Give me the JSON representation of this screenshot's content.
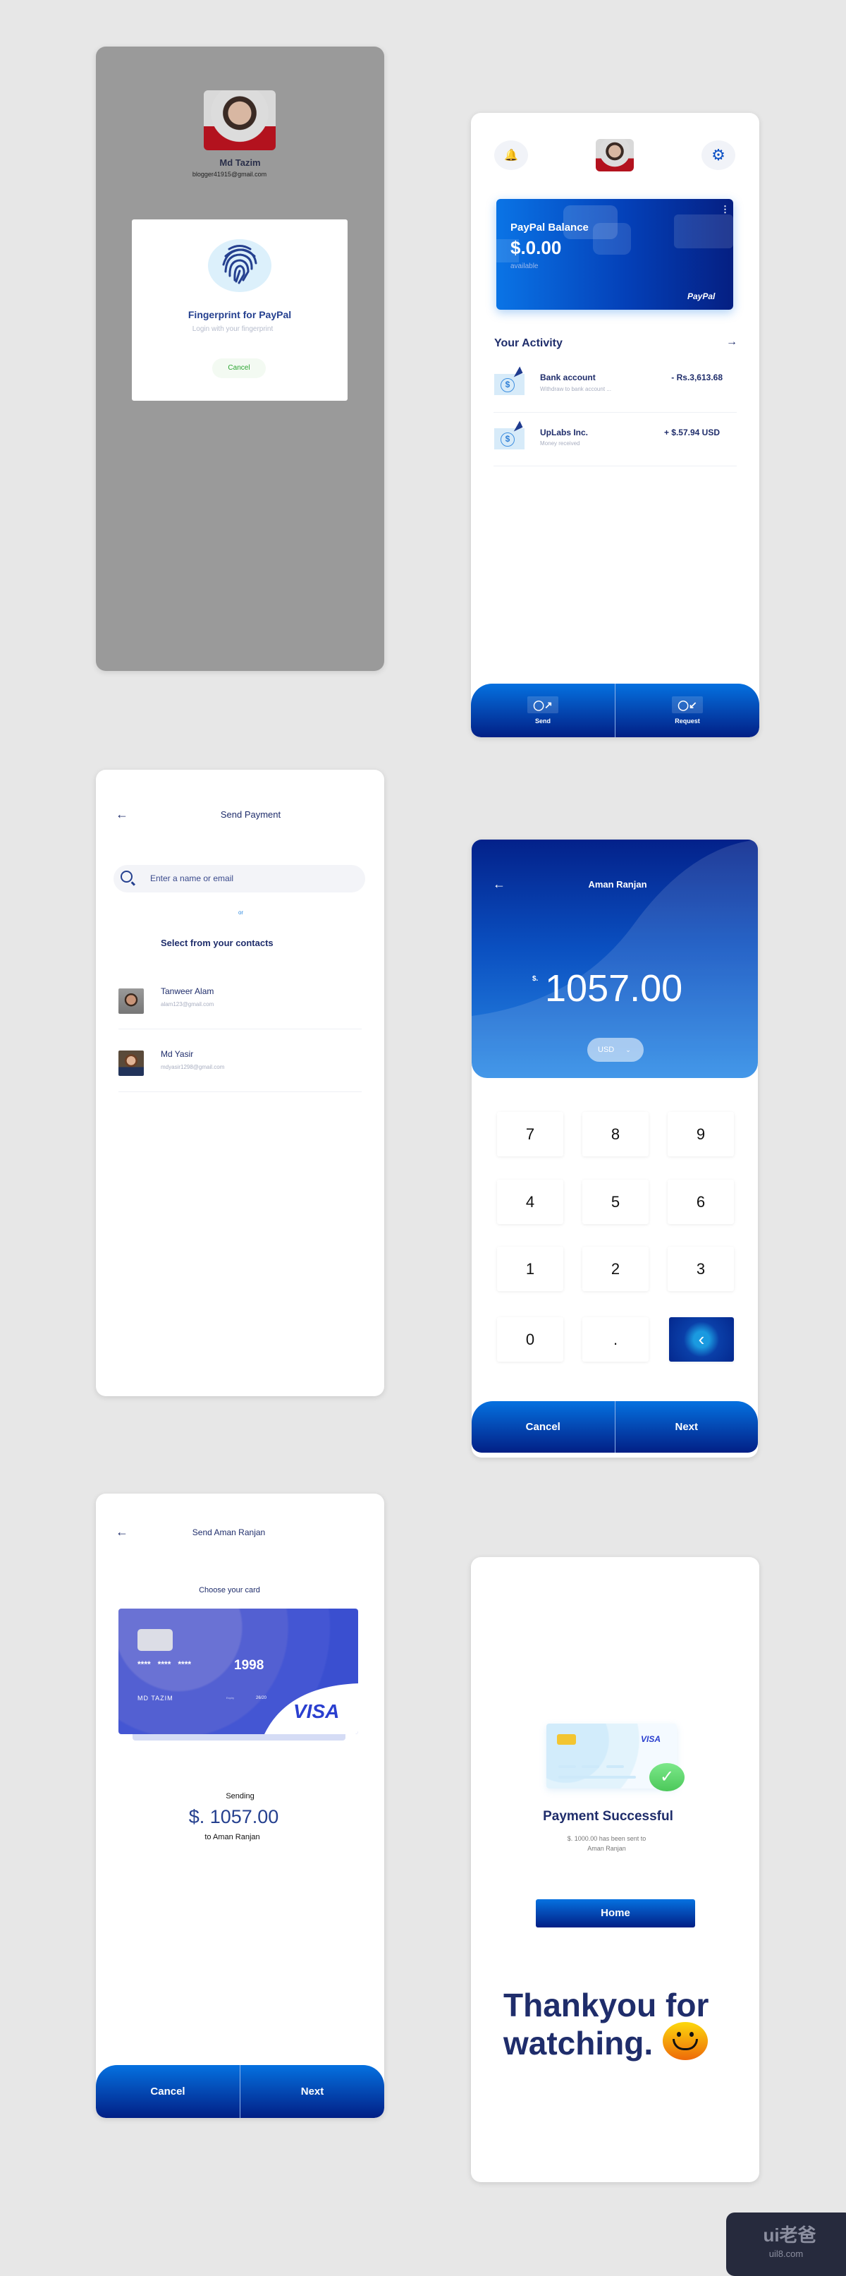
{
  "login": {
    "name": "Md Tazim",
    "email": "blogger41915@gmail.com",
    "modal_title": "Fingerprint for PayPal",
    "modal_subtitle": "Login with your fingerprint",
    "cancel": "Cancel",
    "icon": "fingerprint-icon"
  },
  "home": {
    "balance_title": "PayPal Balance",
    "balance": "$.0.00",
    "available": "available",
    "brand": "PayPal",
    "activity_title": "Your Activity",
    "activity": [
      {
        "title": "Bank account",
        "subtitle": "Withdraw to bank account ...",
        "amount": "- Rs.3,613.68"
      },
      {
        "title": "UpLabs Inc.",
        "subtitle": "Money received",
        "amount": "+ $.57.94 USD"
      }
    ],
    "send": "Send",
    "request": "Request"
  },
  "send_payment": {
    "title": "Send Payment",
    "search_placeholder": "Enter a name or email",
    "or": "or",
    "contacts_title": "Select from your contacts",
    "contacts": [
      {
        "name": "Tanweer Alam",
        "email": "alam123@gmail.com"
      },
      {
        "name": "Md Yasir",
        "email": "mdyasir1298@gmail.com"
      }
    ]
  },
  "amount": {
    "recipient": "Aman Ranjan",
    "currency_symbol": "$.",
    "value": "1057.00",
    "currency": "USD",
    "keys": [
      "7",
      "8",
      "9",
      "4",
      "5",
      "6",
      "1",
      "2",
      "3",
      "0",
      "."
    ],
    "cancel": "Cancel",
    "next": "Next"
  },
  "card_select": {
    "title": "Send Aman Ranjan",
    "choose": "Choose your card",
    "card_mask": "****   ****   ****",
    "card_last": "1998",
    "holder": "MD TAZIM",
    "expiry_label": "Expiry",
    "expiry": "26/20",
    "network": "VISA",
    "sending": "Sending",
    "amount": "$. 1057.00",
    "to": "to Aman Ranjan",
    "cancel": "Cancel",
    "next": "Next"
  },
  "success": {
    "network": "VISA",
    "title": "Payment Successful",
    "line1": "$. 1000.00 has been sent to",
    "line2": "Aman Ranjan",
    "home": "Home",
    "thanks1": "Thankyou for",
    "thanks2": "watching."
  },
  "watermark": {
    "logo": "ui老爸",
    "site": "uil8.com"
  },
  "colors": {
    "navy": "#1f2d6b",
    "blue_top": "#0571e0",
    "blue_bottom": "#021f85",
    "success": "#5fd26a"
  }
}
